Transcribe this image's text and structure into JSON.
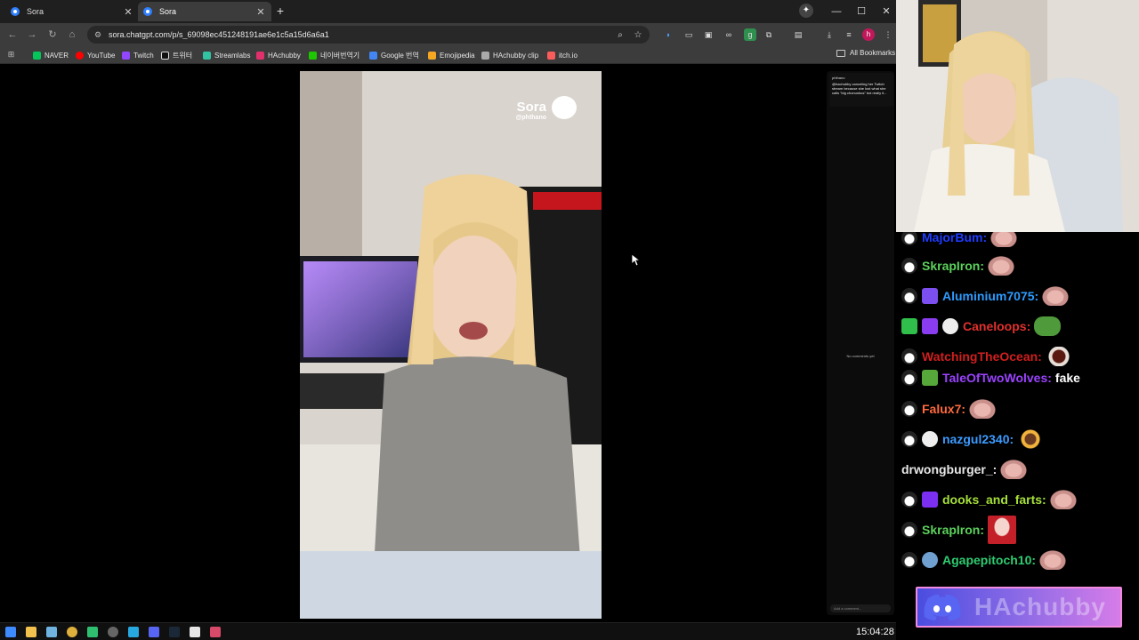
{
  "browser": {
    "tabs": [
      {
        "label": "Sora",
        "close": "✕",
        "active": false
      },
      {
        "label": "Sora",
        "close": "✕",
        "active": true
      }
    ],
    "new_tab": "+",
    "window_controls": {
      "minimize": "—",
      "maximize": "☐",
      "close": "✕"
    },
    "url": "sora.chatgpt.com/p/s_69098ec451248191ae6e1c5a15d6a6a1",
    "bookmarks": [
      {
        "label": "NAVER",
        "color": "#03c75a"
      },
      {
        "label": "YouTube",
        "color": "#ff0000"
      },
      {
        "label": "Twitch",
        "color": "#9146ff"
      },
      {
        "label": "트위터",
        "color": "#111111"
      },
      {
        "label": "Streamlabs",
        "color": "#31c3a2"
      },
      {
        "label": "HAchubby",
        "color": "#e1306c"
      },
      {
        "label": "네이버번역기",
        "color": "#1ec800"
      },
      {
        "label": "Google 번역",
        "color": "#4285f4"
      },
      {
        "label": "Emojipedia",
        "color": "#f5a623"
      },
      {
        "label": "HAchubby clip",
        "color": "#aaaaaa"
      },
      {
        "label": "itch.io",
        "color": "#fa5c5c"
      }
    ],
    "all_bookmarks": "All Bookmarks",
    "profile_initial": "h"
  },
  "video": {
    "watermark_title": "Sora",
    "watermark_handle": "@phthano"
  },
  "side_panel": {
    "user": "phthano",
    "caption": "@hachubby canceling her Twitch stream because she lost what she calls \"big chonunkus\" but really it...",
    "empty_state": "No comments yet",
    "input_placeholder": "Add a comment..."
  },
  "taskbar": {
    "clock": "15:04:28"
  },
  "chat": {
    "messages": [
      {
        "user": "MajorBum:",
        "color": "#1f3cff",
        "text": ""
      },
      {
        "user": "SkrapIron:",
        "color": "#5bd15b",
        "text": ""
      },
      {
        "user": "Aluminium7075:",
        "color": "#2e9bff",
        "text": ""
      },
      {
        "user": "Caneloops:",
        "color": "#e0302e",
        "text": ""
      },
      {
        "user": "WatchingTheOcean:",
        "color": "#d11f1f",
        "text": ""
      },
      {
        "user": "TaleOfTwoWolves:",
        "color": "#9b42ff",
        "text": "fake"
      },
      {
        "user": "Falux7:",
        "color": "#ff6a3d",
        "text": ""
      },
      {
        "user": "nazgul2340:",
        "color": "#3d9bff",
        "text": ""
      },
      {
        "user": "drwongburger_:",
        "color": "#e8e8e8",
        "text": ""
      },
      {
        "user": "dooks_and_farts:",
        "color": "#a6e03a",
        "text": ""
      },
      {
        "user": "SkrapIron:",
        "color": "#5bd15b",
        "text": ""
      },
      {
        "user": "Agapepitoch10:",
        "color": "#2ecc71",
        "text": ""
      }
    ],
    "discord_label": "HAchubby"
  }
}
